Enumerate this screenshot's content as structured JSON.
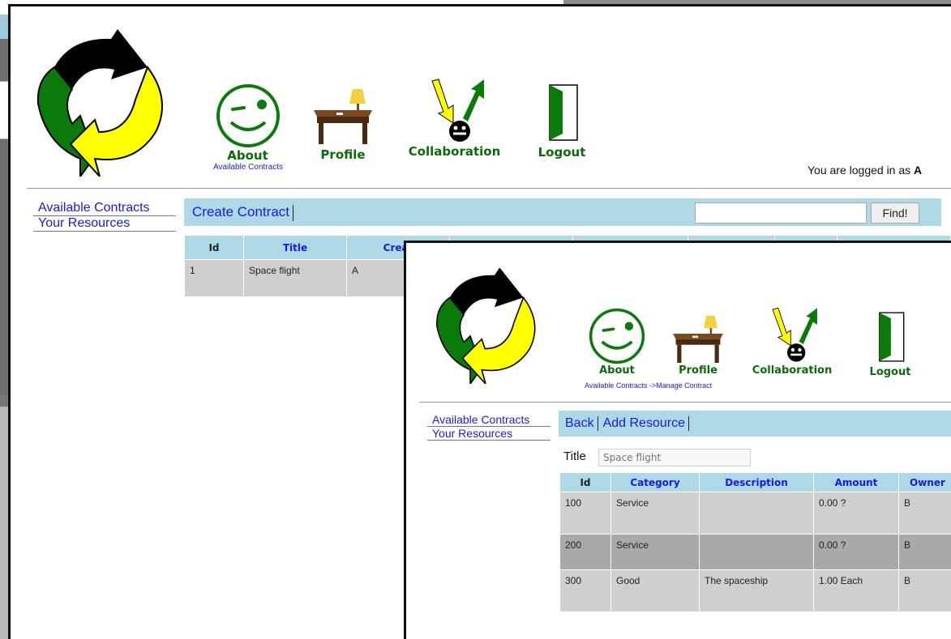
{
  "colors": {
    "accent_green": "#0a6b0a",
    "link_blue": "#1a1ae6",
    "toolbar_blue": "#add8e6",
    "logo_yellow": "#ffff00",
    "logo_black": "#000000"
  },
  "nav": {
    "about": "About",
    "profile": "Profile",
    "collaboration": "Collaboration",
    "logout": "Logout",
    "icons": [
      "smiley-wink-icon",
      "desk-lamp-icon",
      "collaboration-arrows-icon",
      "door-icon"
    ]
  },
  "main_window": {
    "breadcrumb": "Available Contracts",
    "login_prefix": "You are logged in as ",
    "login_user": "A",
    "sidebar": [
      "Available Contracts",
      "Your Resources"
    ],
    "toolbar": {
      "create_contract": "Create Contract",
      "find_button": "Find!",
      "search_value": ""
    },
    "table": {
      "headers": [
        "Id",
        "Title",
        "Creat"
      ],
      "rows": [
        {
          "id": "1",
          "title": "Space flight",
          "creator": "A"
        }
      ]
    }
  },
  "popup_window": {
    "breadcrumb": [
      "Available Contracts",
      " ->",
      "Manage Contract"
    ],
    "sidebar": [
      "Available Contracts",
      "Your Resources"
    ],
    "toolbar": {
      "back": "Back",
      "add_resource": "Add Resource"
    },
    "title_label": "Title",
    "title_placeholder": "Space flight",
    "table": {
      "headers": [
        "Id",
        "Category",
        "Description",
        "Amount",
        "Owner"
      ],
      "rows": [
        {
          "id": "100",
          "category": "Service",
          "description": "",
          "amount": "0.00 ?",
          "owner": "B"
        },
        {
          "id": "200",
          "category": "Service",
          "description": "",
          "amount": "0.00 ?",
          "owner": "B"
        },
        {
          "id": "300",
          "category": "Good",
          "description": "The spaceship",
          "amount": "1.00 Each",
          "owner": "B"
        }
      ]
    }
  }
}
